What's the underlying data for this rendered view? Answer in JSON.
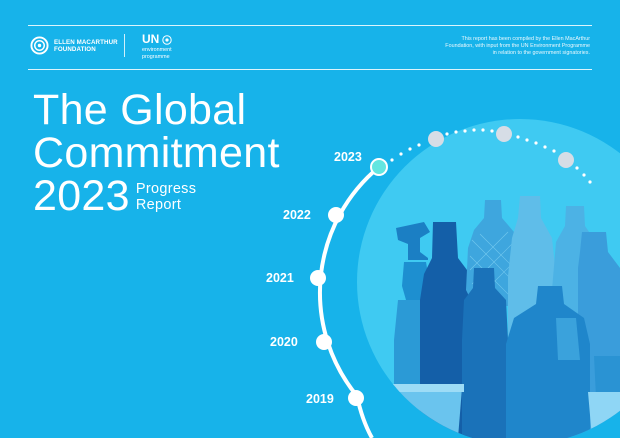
{
  "header": {
    "emf_logo_text": "ELLEN MACARTHUR\nFOUNDATION",
    "emf_line1": "ELLEN MACARTHUR",
    "emf_line2": "FOUNDATION",
    "un_logo": "UN",
    "un_line1": "environment",
    "un_line2": "programme",
    "note_line1": "This report has been compiled by the Ellen MacArthur",
    "note_line2": "Foundation, with input from the UN Environment Programme",
    "note_line3": "in relation to the government signatories."
  },
  "title": {
    "line1": "The Global",
    "line2": "Commitment",
    "year": "2023",
    "sub1": "Progress",
    "sub2": "Report"
  },
  "timeline": {
    "years": [
      "2023",
      "2022",
      "2021",
      "2020",
      "2019"
    ],
    "current": "2023"
  },
  "colors": {
    "background": "#17b3ea",
    "circle": "#3fcaf2",
    "bottles": "#1d8fd0",
    "highlight": "#63e6e0",
    "future_dot": "#d6dde6"
  }
}
